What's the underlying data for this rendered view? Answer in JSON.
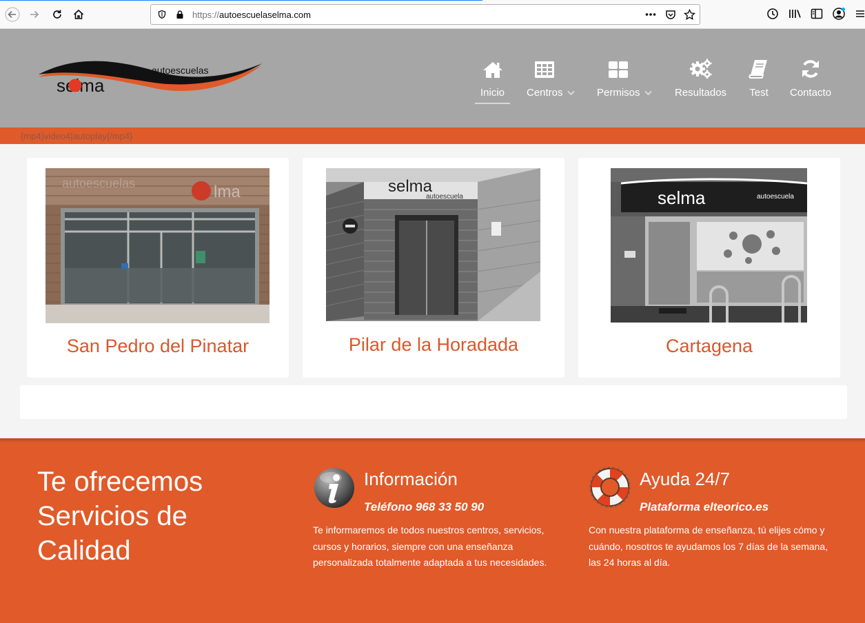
{
  "browser": {
    "url_protocol": "https://",
    "url_host": "autoescuelaselma.com"
  },
  "logo": {
    "brand": "selma",
    "tagline": "autoescuelas"
  },
  "nav": {
    "items": [
      {
        "label": "Inicio",
        "icon": "home-icon",
        "active": true
      },
      {
        "label": "Centros",
        "icon": "table-grid-icon",
        "dropdown": true
      },
      {
        "label": "Permisos",
        "icon": "tiles-icon",
        "dropdown": true
      },
      {
        "label": "Resultados",
        "icon": "gears-icon"
      },
      {
        "label": "Test",
        "icon": "book-icon"
      },
      {
        "label": "Contacto",
        "icon": "refresh-icon"
      }
    ]
  },
  "strip": {
    "text": "{mp4}video4|autoplay{/mp4}"
  },
  "centers": [
    {
      "title": "San Pedro del Pinatar"
    },
    {
      "title": "Pilar de la Horadada"
    },
    {
      "title": "Cartagena"
    }
  ],
  "footer": {
    "offer_lines": [
      "Te ofrecemos",
      "Servicios de",
      "Calidad"
    ],
    "info": {
      "title": "Información",
      "subtitle": "Teléfono 968 33 50 90",
      "text": "Te informaremos de todos nuestros centros, servicios, cursos y horarios, siempre con una enseñanza personalizada totalmente adaptada a tus necesidades."
    },
    "help": {
      "title": "Ayuda 24/7",
      "subtitle": "Plataforma elteorico.es",
      "text": "Con nuestra plataforma de enseñanza, tú elijes cómo y cuándo, nosotros te ayudamos los 7 días de la semana, las 24 horas al día."
    }
  },
  "colors": {
    "brand_orange": "#e05a2a",
    "header_grey": "#a6a6a6",
    "title_orange": "#d9582b"
  }
}
